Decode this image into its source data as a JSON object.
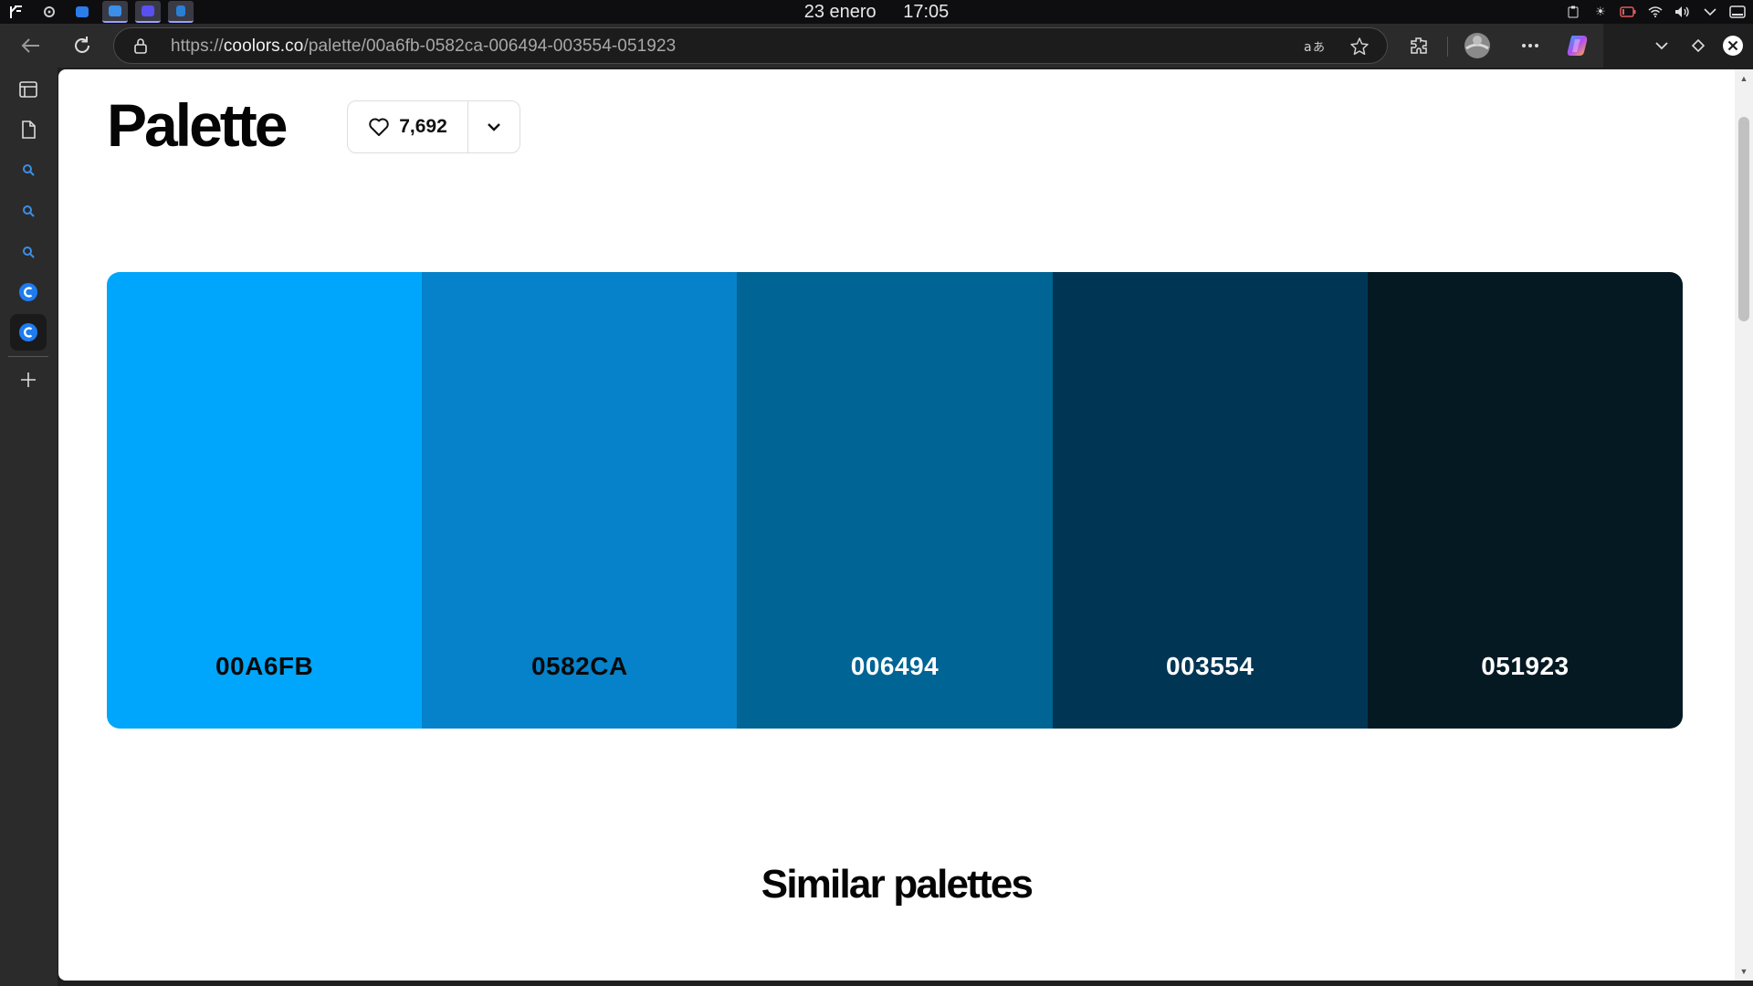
{
  "os_bar": {
    "date": "23  enero",
    "time": "17:05",
    "apps": [
      {
        "name": "system-menu",
        "color": "#ffffff"
      },
      {
        "name": "settings",
        "color": "#cccccc"
      },
      {
        "name": "mail",
        "color": "#2b7de9"
      },
      {
        "name": "files",
        "color": "#3b8fe8"
      },
      {
        "name": "edge-browser",
        "color": "#5a4ff0"
      },
      {
        "name": "vscode",
        "color": "#2a7fd4"
      }
    ]
  },
  "browser": {
    "url_prefix": "https://",
    "url_host": "coolors.co",
    "url_path": "/palette/00a6fb-0582ca-006494-003554-051923"
  },
  "page": {
    "title": "Palette",
    "likes": "7,692",
    "similar_title": "Similar palettes"
  },
  "palette": {
    "colors": [
      {
        "hex": "00A6FB",
        "color": "#00A6FB",
        "text_color": "#0a0a0a"
      },
      {
        "hex": "0582CA",
        "color": "#0582CA",
        "text_color": "#0a0a0a"
      },
      {
        "hex": "006494",
        "color": "#006494",
        "text_color": "#ffffff"
      },
      {
        "hex": "003554",
        "color": "#003554",
        "text_color": "#ffffff"
      },
      {
        "hex": "051923",
        "color": "#051923",
        "text_color": "#ffffff"
      }
    ]
  }
}
